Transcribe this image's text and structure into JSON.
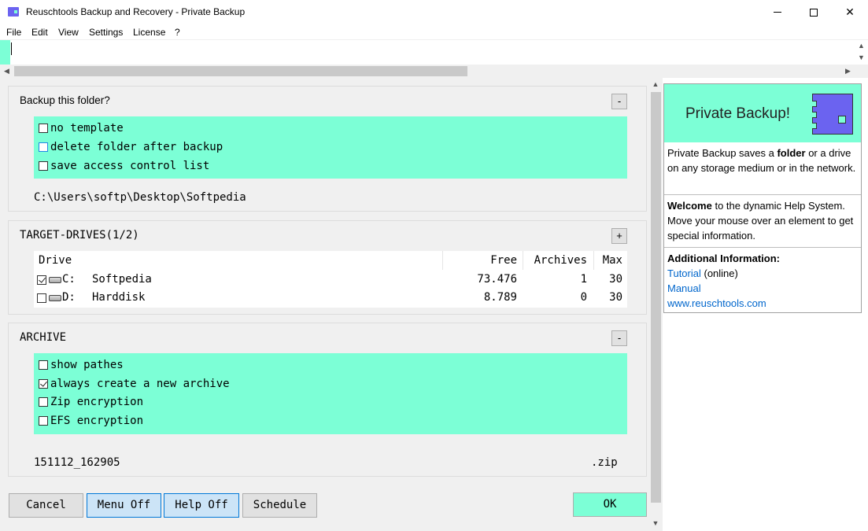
{
  "window": {
    "title": "Reuschtools Backup and Recovery - Private Backup",
    "min_glyph": "",
    "close_glyph": "✕"
  },
  "menu": [
    "File",
    "Edit",
    "View",
    "Settings",
    "License",
    "?"
  ],
  "edit_row": {
    "value": ""
  },
  "folder_panel": {
    "title": "Backup this folder?",
    "toggle": "-",
    "options": [
      {
        "label": "no template",
        "checked": false
      },
      {
        "label": "delete folder after backup",
        "checked": false
      },
      {
        "label": "save access control list",
        "checked": false
      }
    ],
    "path": "C:\\Users\\softp\\Desktop\\Softpedia"
  },
  "drives_panel": {
    "title": "TARGET-DRIVES(1/2)",
    "toggle": "+",
    "columns": {
      "drive": "Drive",
      "free": "Free",
      "archives": "Archives",
      "max": "Max"
    },
    "rows": [
      {
        "checked": true,
        "letter": "C:",
        "name": "Softpedia",
        "free": "73.476",
        "archives": "1",
        "max": "30"
      },
      {
        "checked": false,
        "letter": "D:",
        "name": "Harddisk",
        "free": "8.789",
        "archives": "0",
        "max": "30"
      }
    ]
  },
  "archive_panel": {
    "title": "ARCHIVE",
    "toggle": "-",
    "options": [
      {
        "label": "show pathes",
        "checked": false
      },
      {
        "label": "always create a new archive",
        "checked": true
      },
      {
        "label": "Zip encryption",
        "checked": false
      },
      {
        "label": "EFS encryption",
        "checked": false
      }
    ],
    "filename": "151112_162905",
    "extension": ".zip"
  },
  "buttons": {
    "cancel": "Cancel",
    "menu_off": "Menu Off",
    "help_off": "Help Off",
    "schedule": "Schedule",
    "ok": "OK"
  },
  "help": {
    "header": "Private Backup!",
    "intro_pre": "Private Backup saves a ",
    "intro_bold": "folder",
    "intro_post": " or a drive on any storage medium or in the network.",
    "welcome_bold": "Welcome",
    "welcome_post": " to the dynamic Help System. Move your mouse over an element to get special information.",
    "additional_title": "Additional Information:",
    "tutorial_link": "Tutorial",
    "tutorial_suffix": " (online)",
    "manual_link": "Manual",
    "site_link": "www.reuschtools.com"
  },
  "colors": {
    "accent": "#7cffd6",
    "logo": "#6b63f0",
    "link": "#0066cc"
  }
}
